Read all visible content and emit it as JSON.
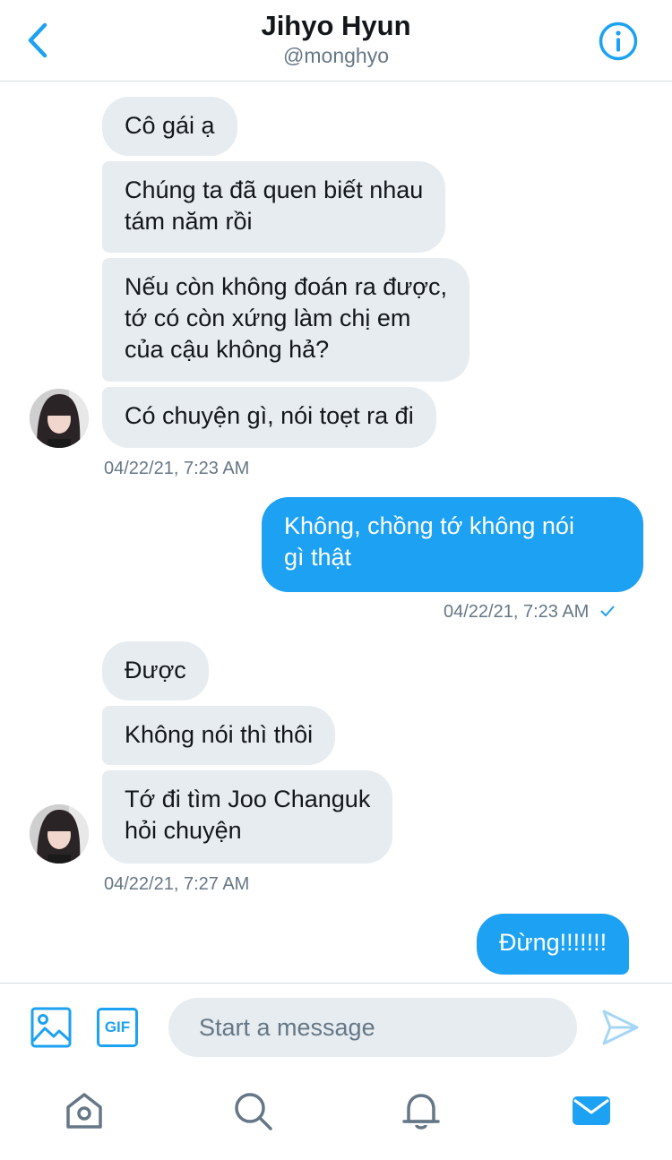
{
  "header": {
    "title": "Jihyo Hyun",
    "handle": "@monghyo",
    "back_icon": "chevron-left-icon",
    "info_icon": "info-icon"
  },
  "messages": {
    "m1": "Cô gái ạ",
    "m2_line1": "Chúng ta đã quen biết nhau",
    "m2_line2": "tám năm rồi",
    "m3_line1": "Nếu còn không đoán ra được,",
    "m3_line2": "tớ có còn xứng làm chị em",
    "m3_line3": "của cậu không hả?",
    "m4": "Có chuyện gì, nói toẹt ra đi",
    "ts1": "04/22/21, 7:23 AM",
    "m5_line1": "Không, chồng tớ không nói",
    "m5_line2": "gì thật",
    "ts2": "04/22/21, 7:23 AM",
    "m6": "Được",
    "m7": "Không nói thì thôi",
    "m8_line1": "Tớ đi tìm Joo Changuk",
    "m8_line2": "hỏi chuyện",
    "ts3": "04/22/21, 7:27 AM",
    "m9": "Đừng!!!!!!!"
  },
  "composer": {
    "placeholder": "Start a message",
    "gif_label": "GIF"
  },
  "colors": {
    "accent": "#1da1f2",
    "incoming_bubble": "#e6ecf0",
    "muted_text": "#657786"
  }
}
